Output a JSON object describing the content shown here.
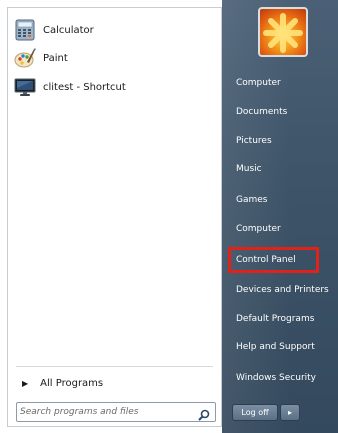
{
  "programs": [
    {
      "label": "Calculator",
      "icon": "calculator-icon"
    },
    {
      "label": "Paint",
      "icon": "paint-icon"
    },
    {
      "label": "clitest - Shortcut",
      "icon": "monitor-icon"
    }
  ],
  "all_programs": {
    "label": "All Programs",
    "icon": "triangle-right-icon"
  },
  "search": {
    "placeholder": "Search programs and files",
    "icon": "search-icon"
  },
  "right_items": [
    "Computer",
    "Documents",
    "Pictures",
    "Music",
    "Games",
    "Computer",
    "Control Panel",
    "Devices and Printers",
    "Default Programs",
    "Help and Support",
    "Windows Security"
  ],
  "highlighted_item": "Control Panel",
  "logoff": {
    "label": "Log off",
    "arrow_icon": "chevron-right-icon"
  },
  "colors": {
    "highlight": "#e0221a",
    "panel": "#3e5468"
  }
}
